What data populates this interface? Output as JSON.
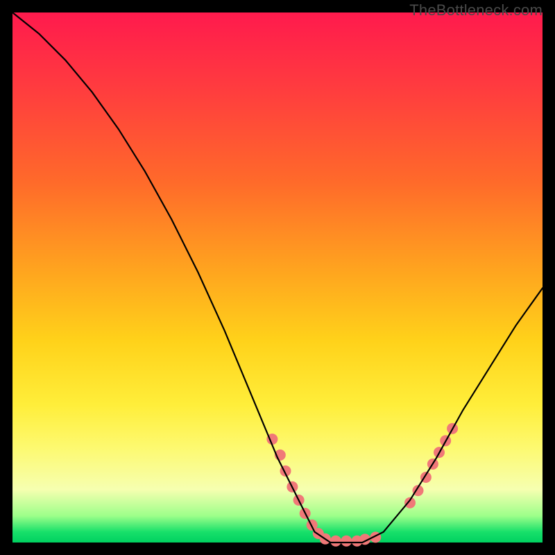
{
  "watermark": "TheBottleneck.com",
  "chart_data": {
    "type": "line",
    "title": "",
    "xlabel": "",
    "ylabel": "",
    "xlim": [
      0,
      100
    ],
    "ylim": [
      0,
      100
    ],
    "grid": false,
    "series": [
      {
        "name": "bottleneck-curve",
        "color": "#000000",
        "x": [
          0,
          5,
          10,
          15,
          20,
          25,
          30,
          35,
          40,
          45,
          50,
          55,
          57,
          60,
          63,
          66,
          70,
          75,
          80,
          85,
          90,
          95,
          100
        ],
        "y": [
          100,
          96,
          91,
          85,
          78,
          70,
          61,
          51,
          40,
          28,
          16,
          6,
          2,
          0,
          0,
          0,
          2,
          8,
          16,
          25,
          33,
          41,
          48
        ]
      }
    ],
    "marker_segments": [
      {
        "name": "left-marker-strip",
        "color": "#f07878",
        "radius": 8,
        "points": [
          {
            "x": 49.0,
            "y": 19.5
          },
          {
            "x": 50.5,
            "y": 16.5
          },
          {
            "x": 51.5,
            "y": 13.5
          },
          {
            "x": 52.8,
            "y": 10.5
          },
          {
            "x": 54.0,
            "y": 8.0
          },
          {
            "x": 55.2,
            "y": 5.5
          },
          {
            "x": 56.5,
            "y": 3.3
          },
          {
            "x": 57.7,
            "y": 1.7
          }
        ]
      },
      {
        "name": "valley-marker-strip",
        "color": "#f07878",
        "radius": 8,
        "points": [
          {
            "x": 59.0,
            "y": 0.7
          },
          {
            "x": 61.0,
            "y": 0.3
          },
          {
            "x": 63.0,
            "y": 0.3
          },
          {
            "x": 65.0,
            "y": 0.3
          },
          {
            "x": 66.5,
            "y": 0.6
          },
          {
            "x": 68.5,
            "y": 1.0
          }
        ]
      },
      {
        "name": "right-marker-strip",
        "color": "#f07878",
        "radius": 8,
        "points": [
          {
            "x": 75.0,
            "y": 7.5
          },
          {
            "x": 76.5,
            "y": 9.8
          },
          {
            "x": 78.0,
            "y": 12.3
          },
          {
            "x": 79.3,
            "y": 14.8
          },
          {
            "x": 80.5,
            "y": 17.0
          },
          {
            "x": 81.7,
            "y": 19.2
          },
          {
            "x": 83.0,
            "y": 21.5
          }
        ]
      }
    ]
  }
}
